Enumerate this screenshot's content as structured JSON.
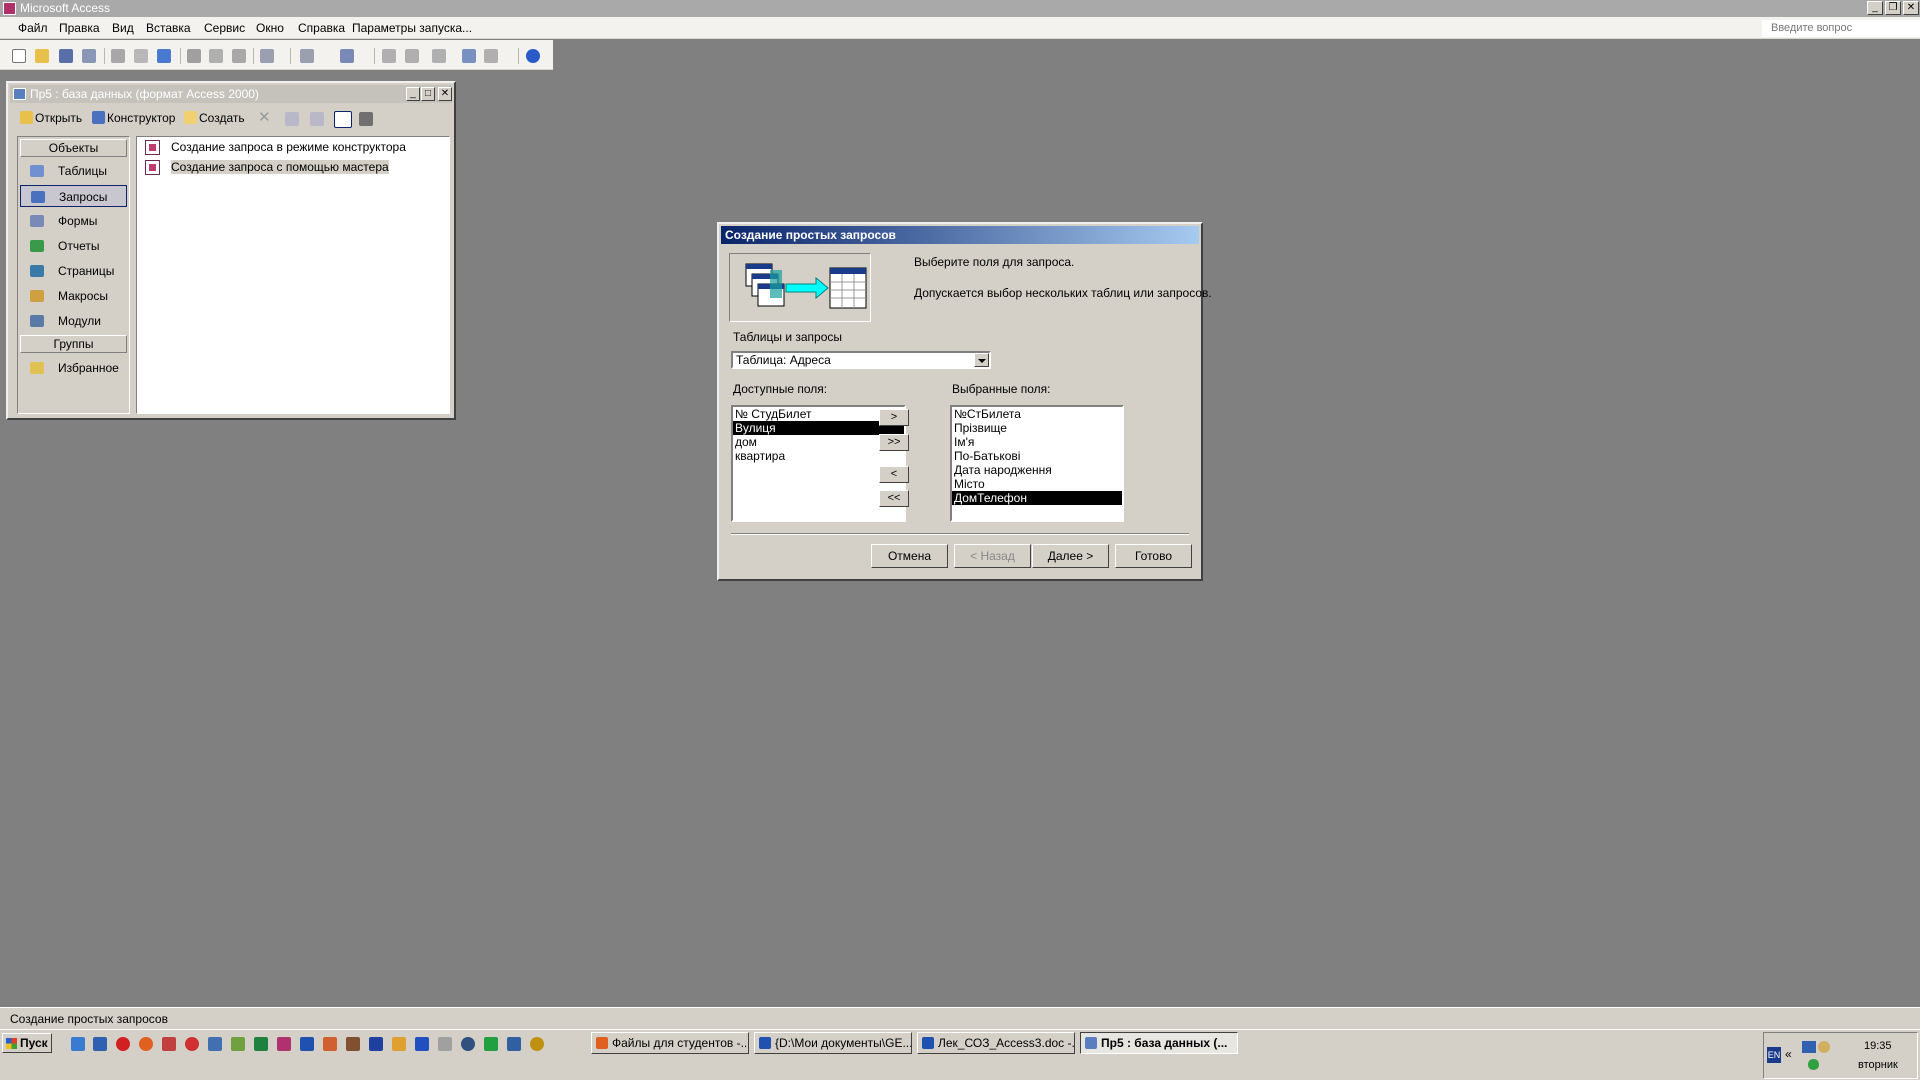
{
  "app": {
    "title": "Microsoft Access",
    "ask_placeholder": "Введите вопрос"
  },
  "menu": [
    "Файл",
    "Правка",
    "Вид",
    "Вставка",
    "Сервис",
    "Окно",
    "Справка",
    "Параметры запуска..."
  ],
  "db_window": {
    "title": "Пр5 : база данных (формат Access 2000)",
    "toolbar": {
      "open": "Открыть",
      "design": "Конструктор",
      "create": "Создать"
    },
    "objects_header": "Объекты",
    "objects": [
      "Таблицы",
      "Запросы",
      "Формы",
      "Отчеты",
      "Страницы",
      "Макросы",
      "Модули"
    ],
    "selected_object": "Запросы",
    "groups_header": "Группы",
    "groups": [
      "Избранное"
    ],
    "queries": [
      "Создание запроса в режиме конструктора",
      "Создание запроса с помощью мастера"
    ]
  },
  "dialog": {
    "title": "Создание простых запросов",
    "instruction": "Выберите поля для запроса.",
    "hint": "Допускается выбор нескольких таблиц или запросов.",
    "tables_label": "Таблицы и запросы",
    "tables_value": "Таблица: Адреса",
    "available_label": "Доступные поля:",
    "available_fields": [
      "№ СтудБилет",
      "Вулиця",
      "дом",
      "квартира"
    ],
    "available_selected": "Вулиця",
    "selected_label": "Выбранные поля:",
    "selected_fields": [
      "№СтБилета",
      "Прізвище",
      "Ім'я",
      "По-Батькові",
      "Дата народження",
      "Місто",
      "ДомТелефон"
    ],
    "selected_selected": "ДомТелефон",
    "move_buttons": [
      ">",
      ">>",
      "<",
      "<<"
    ],
    "buttons": {
      "cancel": "Отмена",
      "back": "< Назад",
      "next": "Далее >",
      "finish": "Готово"
    }
  },
  "status": "Создание простых запросов",
  "taskbar": {
    "start": "Пуск",
    "tasks": [
      "Файлы для студентов -...",
      "{D:\\Мои документы\\GE...",
      "Лек_СОЗ_Access3.doc -...",
      "Пр5 : база данных (..."
    ],
    "active_task": 3,
    "lang": "EN",
    "time": "19:35",
    "day": "вторник"
  }
}
